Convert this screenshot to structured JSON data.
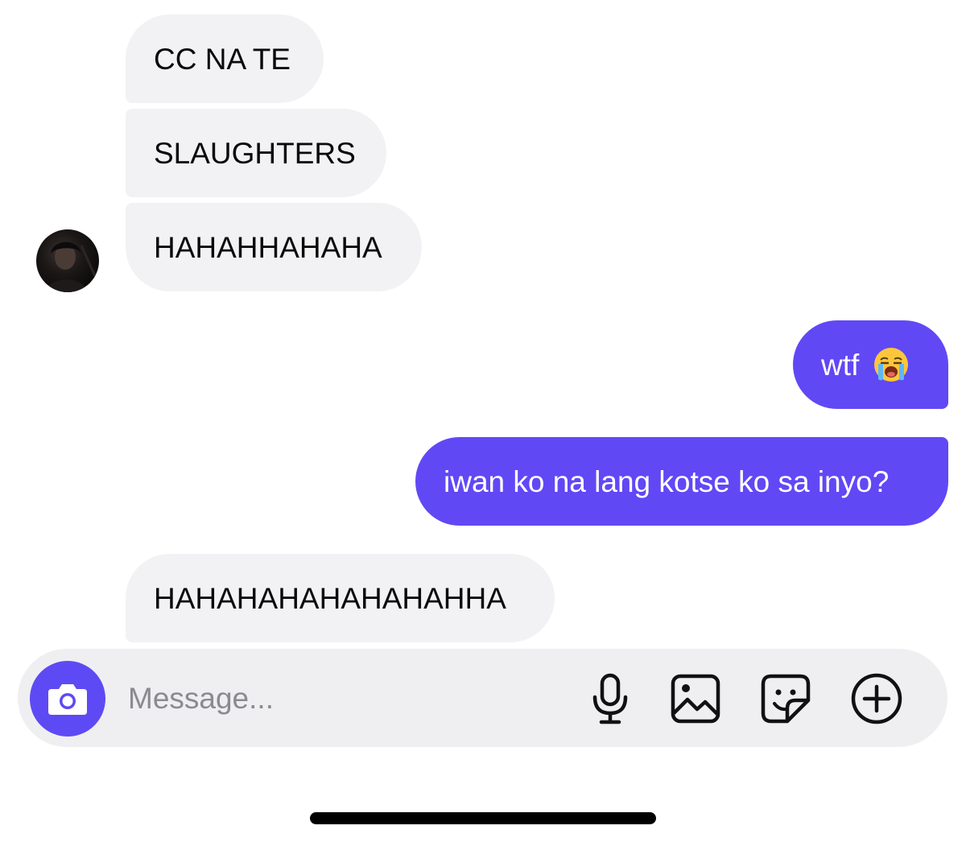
{
  "messages": [
    {
      "direction": "incoming",
      "text": "CC NA TE"
    },
    {
      "direction": "incoming",
      "text": "SLAUGHTERS"
    },
    {
      "direction": "incoming",
      "text": "HAHAHHAHAHA"
    },
    {
      "direction": "outgoing",
      "text": "wtf",
      "emoji": "loudly-crying-face"
    },
    {
      "direction": "outgoing",
      "text": "iwan ko na lang kotse ko sa inyo?"
    },
    {
      "direction": "incoming",
      "text": "HAHAHAHAHAHAHAHHA"
    }
  ],
  "composer": {
    "placeholder": "Message...",
    "value": "",
    "buttons": [
      "camera-icon",
      "microphone-icon",
      "gallery-icon",
      "sticker-icon",
      "plus-icon"
    ]
  },
  "colors": {
    "outgoing_bubble": "#6048f5",
    "incoming_bubble": "#f2f2f4",
    "camera_button": "#5e4af4"
  }
}
